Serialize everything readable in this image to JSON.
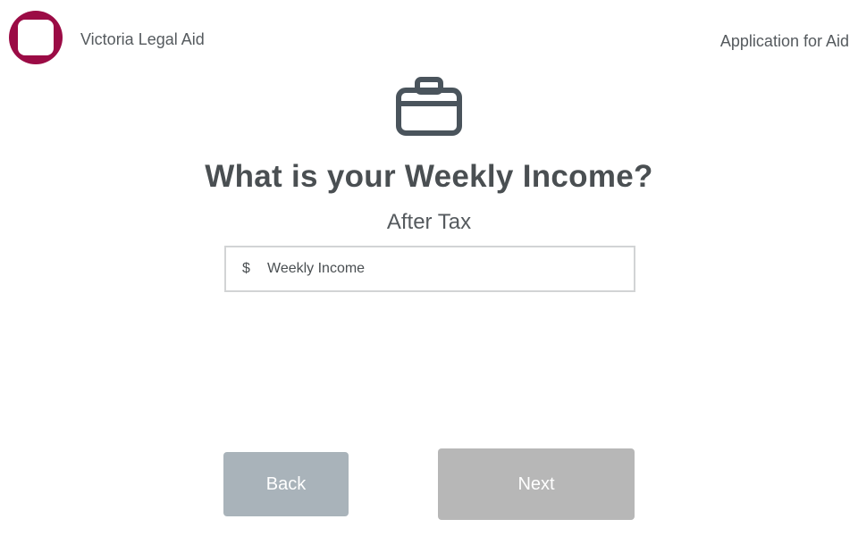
{
  "header": {
    "org_name": "Victoria Legal Aid",
    "app_title": "Application for Aid",
    "brand_color": "#9b0b45"
  },
  "main": {
    "icon": "briefcase-icon",
    "question": "What is your Weekly Income?",
    "subtitle": "After Tax",
    "income_field": {
      "currency_symbol": "$",
      "value": "",
      "placeholder": "Weekly Income"
    }
  },
  "footer": {
    "back_label": "Back",
    "next_label": "Next",
    "back_color": "#a9b3ba",
    "next_color": "#b7b7b7"
  }
}
